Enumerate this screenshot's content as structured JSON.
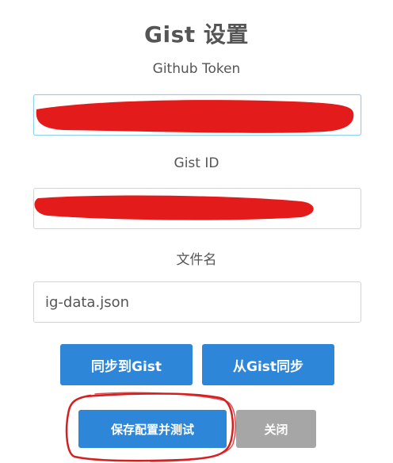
{
  "dialog": {
    "title": "Gist 设置"
  },
  "token_field": {
    "label": "Github Token",
    "value": ""
  },
  "gist_id_field": {
    "label": "Gist ID",
    "value": ""
  },
  "filename_field": {
    "label": "文件名",
    "value": "ig-data.json"
  },
  "buttons": {
    "sync_to_gist": "同步到Gist",
    "sync_from_gist": "从Gist同步",
    "save_and_test": "保存配置并测试",
    "close": "关闭"
  },
  "colors": {
    "primary": "#2e86d8",
    "secondary": "#a6a6a6",
    "title_text": "#555555",
    "redaction": "#e31b1b",
    "annotation": "#d42020"
  }
}
